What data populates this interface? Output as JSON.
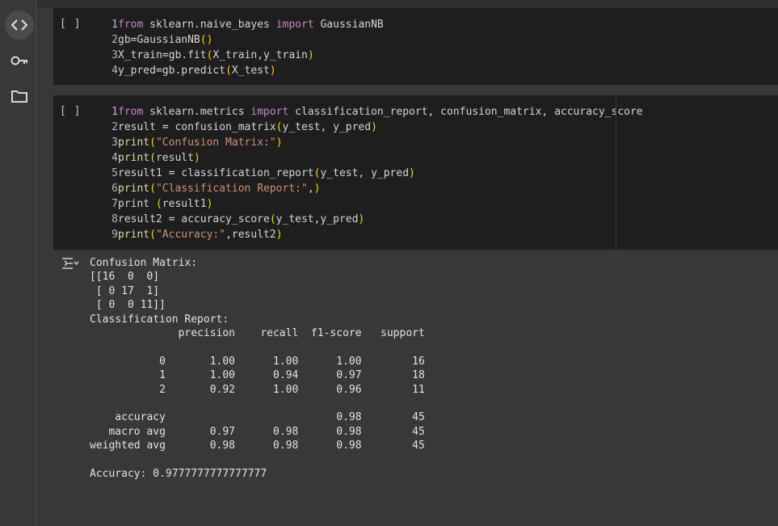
{
  "sidebar": {
    "items": [
      {
        "icon": "code-icon"
      },
      {
        "icon": "key-icon"
      },
      {
        "icon": "folder-icon"
      }
    ]
  },
  "cells": [
    {
      "run_label": "[ ]",
      "lines": [
        {
          "no": "1",
          "tokens": [
            [
              "kw",
              "from"
            ],
            [
              "plain",
              " sklearn.naive_bayes "
            ],
            [
              "kw",
              "import"
            ],
            [
              "plain",
              " GaussianNB"
            ]
          ]
        },
        {
          "no": "2",
          "tokens": [
            [
              "plain",
              "gb=GaussianNB"
            ],
            [
              "par",
              "()"
            ]
          ]
        },
        {
          "no": "3",
          "tokens": [
            [
              "plain",
              "X_train=gb.fit"
            ],
            [
              "par",
              "("
            ],
            [
              "plain",
              "X_train,y_train"
            ],
            [
              "par",
              ")"
            ]
          ]
        },
        {
          "no": "4",
          "tokens": [
            [
              "plain",
              "y_pred=gb.predict"
            ],
            [
              "par",
              "("
            ],
            [
              "plain",
              "X_test"
            ],
            [
              "par",
              ")"
            ]
          ]
        }
      ]
    },
    {
      "run_label": "[ ]",
      "lines": [
        {
          "no": "1",
          "tokens": [
            [
              "kw",
              "from"
            ],
            [
              "plain",
              " sklearn.metrics "
            ],
            [
              "kw",
              "import"
            ],
            [
              "plain",
              " classification_report, confusion_matrix, accuracy_score"
            ]
          ]
        },
        {
          "no": "2",
          "tokens": [
            [
              "plain",
              "result = confusion_matrix"
            ],
            [
              "par",
              "("
            ],
            [
              "plain",
              "y_test, y_pred"
            ],
            [
              "par",
              ")"
            ]
          ]
        },
        {
          "no": "3",
          "tokens": [
            [
              "fn",
              "print"
            ],
            [
              "par",
              "("
            ],
            [
              "str",
              "\"Confusion Matrix:\""
            ],
            [
              "par",
              ")"
            ]
          ]
        },
        {
          "no": "4",
          "tokens": [
            [
              "fn",
              "print"
            ],
            [
              "par",
              "("
            ],
            [
              "plain",
              "result"
            ],
            [
              "par",
              ")"
            ]
          ]
        },
        {
          "no": "5",
          "tokens": [
            [
              "plain",
              "result1 = classification_report"
            ],
            [
              "par",
              "("
            ],
            [
              "plain",
              "y_test, y_pred"
            ],
            [
              "par",
              ")"
            ]
          ]
        },
        {
          "no": "6",
          "tokens": [
            [
              "fn",
              "print"
            ],
            [
              "par",
              "("
            ],
            [
              "str",
              "\"Classification Report:\""
            ],
            [
              "plain",
              ","
            ],
            [
              "par",
              ")"
            ]
          ]
        },
        {
          "no": "7",
          "tokens": [
            [
              "plain",
              "print "
            ],
            [
              "par",
              "("
            ],
            [
              "plain",
              "result1"
            ],
            [
              "par",
              ")"
            ]
          ]
        },
        {
          "no": "8",
          "tokens": [
            [
              "plain",
              "result2 = accuracy_score"
            ],
            [
              "par",
              "("
            ],
            [
              "plain",
              "y_test,y_pred"
            ],
            [
              "par",
              ")"
            ]
          ]
        },
        {
          "no": "9",
          "tokens": [
            [
              "fn",
              "print"
            ],
            [
              "par",
              "("
            ],
            [
              "str",
              "\"Accuracy:\""
            ],
            [
              "plain",
              ",result2"
            ],
            [
              "par",
              ")"
            ]
          ]
        }
      ]
    }
  ],
  "output": {
    "text": "Confusion Matrix:\n[[16  0  0]\n [ 0 17  1]\n [ 0  0 11]]\nClassification Report:\n              precision    recall  f1-score   support\n\n           0       1.00      1.00      1.00        16\n           1       1.00      0.94      0.97        18\n           2       0.92      1.00      0.96        11\n\n    accuracy                           0.98        45\n   macro avg       0.97      0.98      0.98        45\nweighted avg       0.98      0.98      0.98        45\n\nAccuracy: 0.9777777777777777"
  }
}
